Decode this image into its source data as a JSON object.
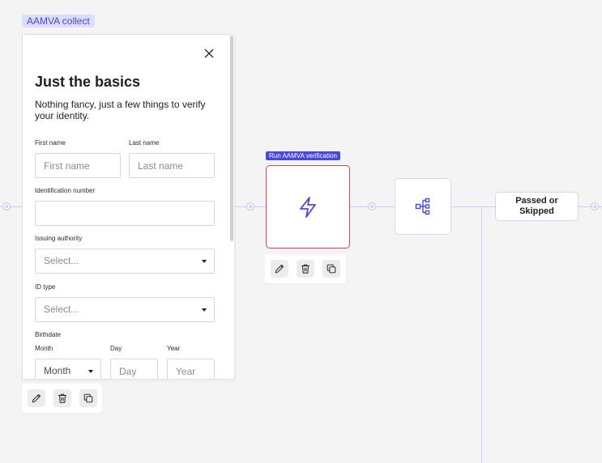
{
  "colors": {
    "accent": "#4a46e0",
    "selected_border": "#e6433f",
    "edge": "#c9ccf3",
    "canvas": "#f4f4f5"
  },
  "group_tag": "AAMVA collect",
  "form": {
    "title": "Just the basics",
    "subtitle": "Nothing fancy, just a few things to verify your identity.",
    "first_name": {
      "label": "First name",
      "placeholder": "First name"
    },
    "last_name": {
      "label": "Last name",
      "placeholder": "Last name"
    },
    "id_number": {
      "label": "Identification number",
      "placeholder": ""
    },
    "issuing_authority": {
      "label": "Issuing authority",
      "value": "Select..."
    },
    "id_type": {
      "label": "ID type",
      "value": "Select..."
    },
    "birthdate": {
      "label": "Birthdate",
      "month": {
        "label": "Month",
        "value": "Month"
      },
      "day": {
        "label": "Day",
        "placeholder": "Day"
      },
      "year": {
        "label": "Year",
        "placeholder": "Year"
      }
    }
  },
  "action_node": {
    "tag": "Run AAMVA verification",
    "icon": "lightning-icon"
  },
  "branch_node": {
    "icon": "branch-icon"
  },
  "result_node": {
    "label": "Passed or Skipped"
  },
  "toolbar_icons": [
    "pencil-icon",
    "trash-icon",
    "copy-icon"
  ]
}
